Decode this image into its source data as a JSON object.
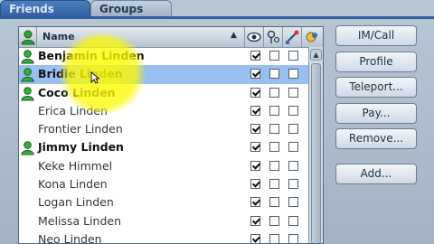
{
  "tabs": [
    {
      "label": "Friends",
      "active": true
    },
    {
      "label": "Groups",
      "active": false
    }
  ],
  "list": {
    "header": {
      "name_label": "Name",
      "sort_direction": "ascending",
      "columns": [
        "online-status-icon",
        "eye-icon",
        "map-pin-icon",
        "edit-objects-icon",
        "sort-icon"
      ]
    },
    "rows": [
      {
        "name": "Benjamin Linden",
        "online": true,
        "checks": [
          true,
          false,
          false,
          false
        ]
      },
      {
        "name": "Bridie Linden",
        "online": true,
        "checks": [
          true,
          false,
          false,
          false
        ],
        "selected": true
      },
      {
        "name": "Coco Linden",
        "online": true,
        "checks": [
          true,
          false,
          false,
          false
        ]
      },
      {
        "name": "Erica Linden",
        "online": false,
        "checks": [
          true,
          false,
          false,
          false
        ]
      },
      {
        "name": "Frontier Linden",
        "online": false,
        "checks": [
          true,
          false,
          false,
          false
        ]
      },
      {
        "name": "Jimmy Linden",
        "online": true,
        "checks": [
          true,
          false,
          false,
          false
        ]
      },
      {
        "name": "Keke Himmel",
        "online": false,
        "checks": [
          true,
          false,
          false,
          false
        ]
      },
      {
        "name": "Kona Linden",
        "online": false,
        "checks": [
          true,
          false,
          false,
          false
        ]
      },
      {
        "name": "Logan Linden",
        "online": false,
        "checks": [
          true,
          false,
          false,
          false
        ]
      },
      {
        "name": "Melissa Linden",
        "online": false,
        "checks": [
          true,
          false,
          false,
          false
        ]
      },
      {
        "name": "Neo Linden",
        "online": false,
        "checks": [
          true,
          false,
          false,
          false
        ]
      }
    ]
  },
  "buttons": {
    "im_call": "IM/Call",
    "profile": "Profile",
    "teleport": "Teleport...",
    "pay": "Pay...",
    "remove": "Remove...",
    "add": "Add..."
  },
  "colors": {
    "selected_row": "#98bff0",
    "highlight": "#fffc00",
    "active_tab": "#2f5f9f"
  }
}
